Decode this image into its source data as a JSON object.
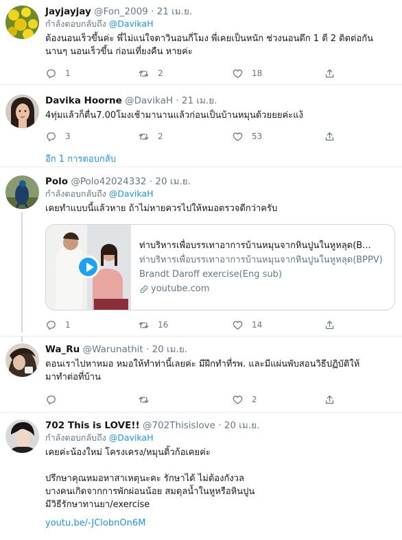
{
  "tweets": [
    {
      "name": "Jayjayjay",
      "handle": "@Fon_2009",
      "date": "21 เม.ย.",
      "reply_prefix": "กำลังตอบกลับถึง",
      "reply_to": "@DavikaH",
      "text": "ต้องนอนเร็วขึ้นค่ะ พี่ไม่แน่ใจดาวินอนกี่โมง พี่เคยเป็นหนัก ช่วงนอนดึก 1 ตี 2 ติดต่อกัน\nนานๆ นอนเร็วขึ้น ก่อนเที่ยงคืน หายค่ะ",
      "replies": "1",
      "retweets": "2",
      "likes": "18"
    },
    {
      "name": "Davika Hoorne",
      "handle": "@DavikaH",
      "date": "21 เม.ย.",
      "text": "4ทุ่มแล้วก็ตื่น7.00โมงเช้ามานานแล้วก่อนเป็นบ้านหมุนด้วยยยค่ะแง้",
      "replies": "3",
      "retweets": "2",
      "likes": "53",
      "more_replies": "อีก 1 การตอบกลับ"
    },
    {
      "name": "Polo",
      "handle": "@Polo42024332",
      "date": "20 เม.ย.",
      "reply_prefix": "กำลังตอบกลับถึง",
      "reply_to": "@DavikaH",
      "text": "เคยทำแบบนี้แล้วหาย ถ้าไม่หายควรไปให้หมอตรวจดีกว่าครับ",
      "card": {
        "title": "ท่าบริหารเพื่อบรรเทาอาการบ้านหมุนจากหินปูนในหูหลุด(B...",
        "description": "ท่าบริหารเพื่อบรรเทาอาการบ้านหมุนจากหินปูนในหูหลุด(BPPV) Brandt Daroff exercise(Eng sub)",
        "domain": "youtube.com"
      },
      "replies": "1",
      "retweets": "16",
      "likes": "14"
    },
    {
      "name": "Wa_Ru",
      "handle": "@Warunathit",
      "date": "20 เม.ย.",
      "text": "ตอนเราไปหาหมอ หมอให้ทำท่านี้เลยค่ะ มีฝึกทำที่รพ. และมีแผ่นพับสอนวิธีปฏิบัติให้\nมาทำต่อที่บ้าน",
      "replies": "",
      "retweets": "",
      "likes": "2"
    },
    {
      "name": "702 This is LOVE!!",
      "handle": "@702Thisislove",
      "date": "20 เม.ย.",
      "reply_prefix": "กำลังตอบกลับถึง",
      "reply_to": "@DavikaH",
      "text": "เคยค่ะน้องใหม่ โครงเครง/หมุนติ้วก้อเคยค่ะ\n\nปรึกษาคุณหมอหาสาเหตุนะคะ รักษาได้ ไม่ต้องกังวล\nบางคนเกิดจากการพักผ่อนน้อย สมดุลน้ำในหูหรือหินปูน\nมีวิธีรักษาทานยา/exercise",
      "link": "youtu.be/-JClobnOn6M"
    }
  ],
  "sep": "·",
  "colors": {
    "accent": "#1b95e0",
    "muted": "#657786",
    "border": "#e6ecf0",
    "text": "#14171a"
  },
  "icons": [
    "reply-icon",
    "retweet-icon",
    "like-icon",
    "share-icon",
    "link-icon",
    "play-icon"
  ]
}
